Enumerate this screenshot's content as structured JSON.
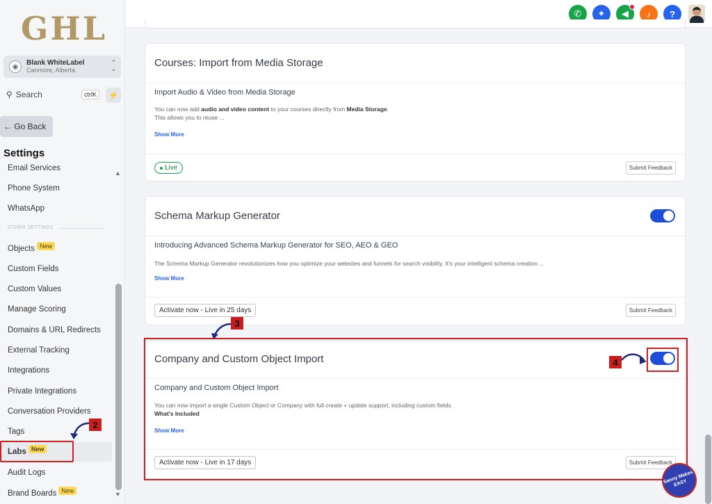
{
  "logo": "GHL",
  "account": {
    "name": "Blank WhiteLabel",
    "location": "Canmore, Alberta"
  },
  "search": {
    "label": "Search",
    "shortcut": "ctrlK"
  },
  "go_back": "← Go Back",
  "settings_title": "Settings",
  "nav": {
    "email_services": "Email Services",
    "phone_system": "Phone System",
    "whatsapp": "WhatsApp",
    "other_settings": "OTHER SETTINGS",
    "objects": "Objects",
    "custom_fields": "Custom Fields",
    "custom_values": "Custom Values",
    "manage_scoring": "Manage Scoring",
    "domains": "Domains & URL Redirects",
    "external_tracking": "External Tracking",
    "integrations": "Integrations",
    "private_integrations": "Private Integrations",
    "conversation_providers": "Conversation Providers",
    "tags": "Tags",
    "labs": "Labs",
    "audit_logs": "Audit Logs",
    "brand_boards": "Brand Boards",
    "new_badge": "New"
  },
  "cards": [
    {
      "title": "Courses: Import from Media Storage",
      "heading": "Import Audio & Video from Media Storage",
      "desc_pre": "You can now add ",
      "desc_bold1": "audio and video content",
      "desc_mid": " to your courses directly from ",
      "desc_bold2": "Media Storage",
      "desc_post": ".",
      "desc_line2": "This allows you to reuse ...",
      "show_more": "Show More",
      "status": "Live",
      "feedback": "Submit Feedback"
    },
    {
      "title": "Schema Markup Generator",
      "heading": "Introducing Advanced Schema Markup Generator for SEO, AEO & GEO",
      "desc": "The Schema Markup Generator revolutionizes how you optimize your websites and funnels for search visibility. It's your intelligent schema creation ...",
      "show_more": "Show More",
      "activate": "Activate now - Live in 25 days",
      "feedback": "Submit Feedback",
      "enabled": true
    },
    {
      "title": "Company and Custom Object Import",
      "heading": "Company and Custom Object Import",
      "desc": "You can now import a single Custom Object or Company with full create + update support, including custom fields.",
      "desc_bold": "What's Included",
      "show_more": "Show More",
      "activate": "Activate now - Live in 17 days",
      "feedback": "Submit Feedback",
      "enabled": true
    }
  ],
  "annotations": {
    "step2": "2",
    "step3": "3",
    "step4": "4"
  },
  "watermark": "Sanny Makes EASY",
  "colors": {
    "accent": "#1d4ed8",
    "highlight": "#cc2020",
    "live": "#16a34a",
    "badge": "#f8d95c"
  },
  "icons": [
    "phone-icon",
    "satellite-icon",
    "megaphone-icon",
    "bell-icon",
    "help-icon"
  ]
}
